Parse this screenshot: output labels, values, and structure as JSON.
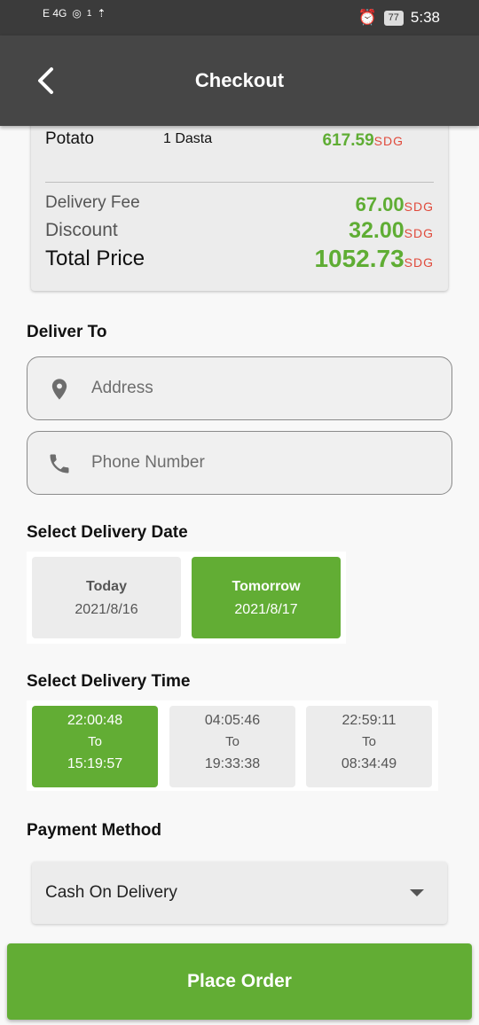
{
  "status_bar": {
    "network": "E 4G",
    "notification_count": "1",
    "battery": "77",
    "time": "5:38"
  },
  "appbar": {
    "title": "Checkout",
    "back_icon": "chevron-left-icon"
  },
  "order_summary": {
    "item": {
      "name": "Potato",
      "quantity": "1  Dasta",
      "price": "617.59",
      "currency": "SDG"
    },
    "delivery_fee": {
      "label": "Delivery Fee",
      "value": "67.00",
      "currency": "SDG"
    },
    "discount": {
      "label": "Discount",
      "value": "32.00",
      "currency": "SDG"
    },
    "total": {
      "label": "Total Price",
      "value": "1052.73",
      "currency": "SDG"
    }
  },
  "deliver_to": {
    "title": "Deliver To",
    "address_placeholder": "Address",
    "phone_placeholder": "Phone Number"
  },
  "delivery_date": {
    "title": "Select Delivery Date",
    "options": [
      {
        "label": "Today",
        "date": "2021/8/16",
        "selected": false
      },
      {
        "label": "Tomorrow",
        "date": "2021/8/17",
        "selected": true
      }
    ]
  },
  "delivery_time": {
    "title": "Select Delivery Time",
    "options": [
      {
        "from": "22:00:48",
        "to_label": "To",
        "to": "15:19:57",
        "selected": true
      },
      {
        "from": "04:05:46",
        "to_label": "To",
        "to": "19:33:38",
        "selected": false
      },
      {
        "from": "22:59:11",
        "to_label": "To",
        "to": "08:34:49",
        "selected": false
      }
    ]
  },
  "payment": {
    "title": "Payment Method",
    "selected": "Cash On Delivery"
  },
  "place_order": {
    "label": "Place Order"
  },
  "colors": {
    "accent_green": "#62ad34",
    "currency_red": "#e04a3b",
    "appbar": "#464646"
  }
}
